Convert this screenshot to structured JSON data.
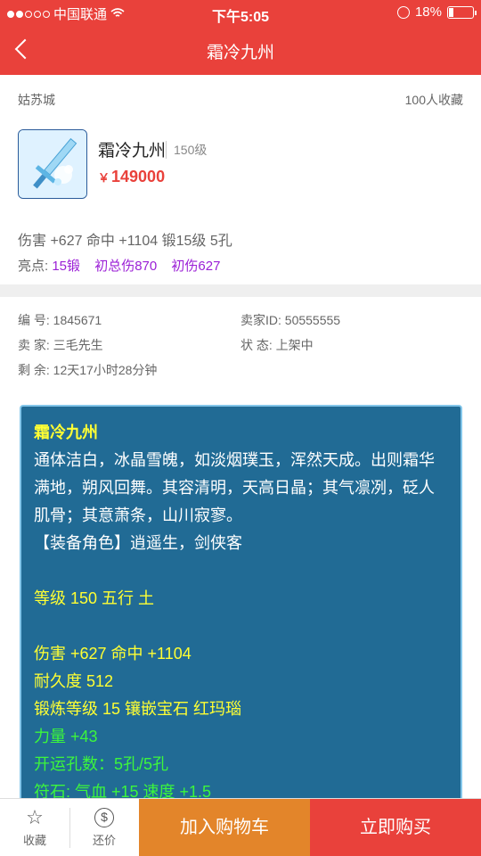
{
  "status_bar": {
    "carrier": "中国联通",
    "time": "下午5:05",
    "battery": "18%"
  },
  "nav": {
    "title": "霜冷九州"
  },
  "item": {
    "server": "姑苏城",
    "favorites": "100人收藏",
    "name": "霜冷九州",
    "level": "150级",
    "currency": "￥",
    "price": "149000",
    "stats": "伤害 +627 命中 +1104  锻15级  5孔",
    "highlights_label": "亮点:",
    "highlights": [
      "15锻",
      "初总伤870",
      "初伤627"
    ]
  },
  "info": {
    "serial_label": "编   号:",
    "serial": "1845671",
    "seller_id_label": "卖家ID:",
    "seller_id": "50555555",
    "seller_label": "卖   家:",
    "seller": "三毛先生",
    "status_label": "状   态:",
    "status": "上架中",
    "remaining_label": "剩   余:",
    "remaining": "12天17小时28分钟"
  },
  "description": {
    "title": "霜冷九州",
    "lines": [
      "通体洁白，冰晶雪魄，如淡烟璞玉，浑然天成。出则霜华",
      "满地，朔风回舞。其容清明，天高日晶；其气凛冽，砭人",
      "肌骨；其意萧条，山川寂寥。",
      "【装备角色】逍遥生，剑侠客"
    ],
    "level_line": "等级 150 五行 土",
    "attr_lines": [
      "伤害 +627 命中 +1104",
      "耐久度 512",
      "锻炼等级 15 镶嵌宝石 红玛瑙"
    ],
    "green_lines": [
      "力量 +43",
      "开运孔数：5孔/5孔",
      "符石: 气血 +15 速度 +1.5"
    ]
  },
  "bottom_bar": {
    "favorite": "收藏",
    "bargain": "还价",
    "add_to_cart": "加入购物车",
    "buy_now": "立即购买"
  }
}
